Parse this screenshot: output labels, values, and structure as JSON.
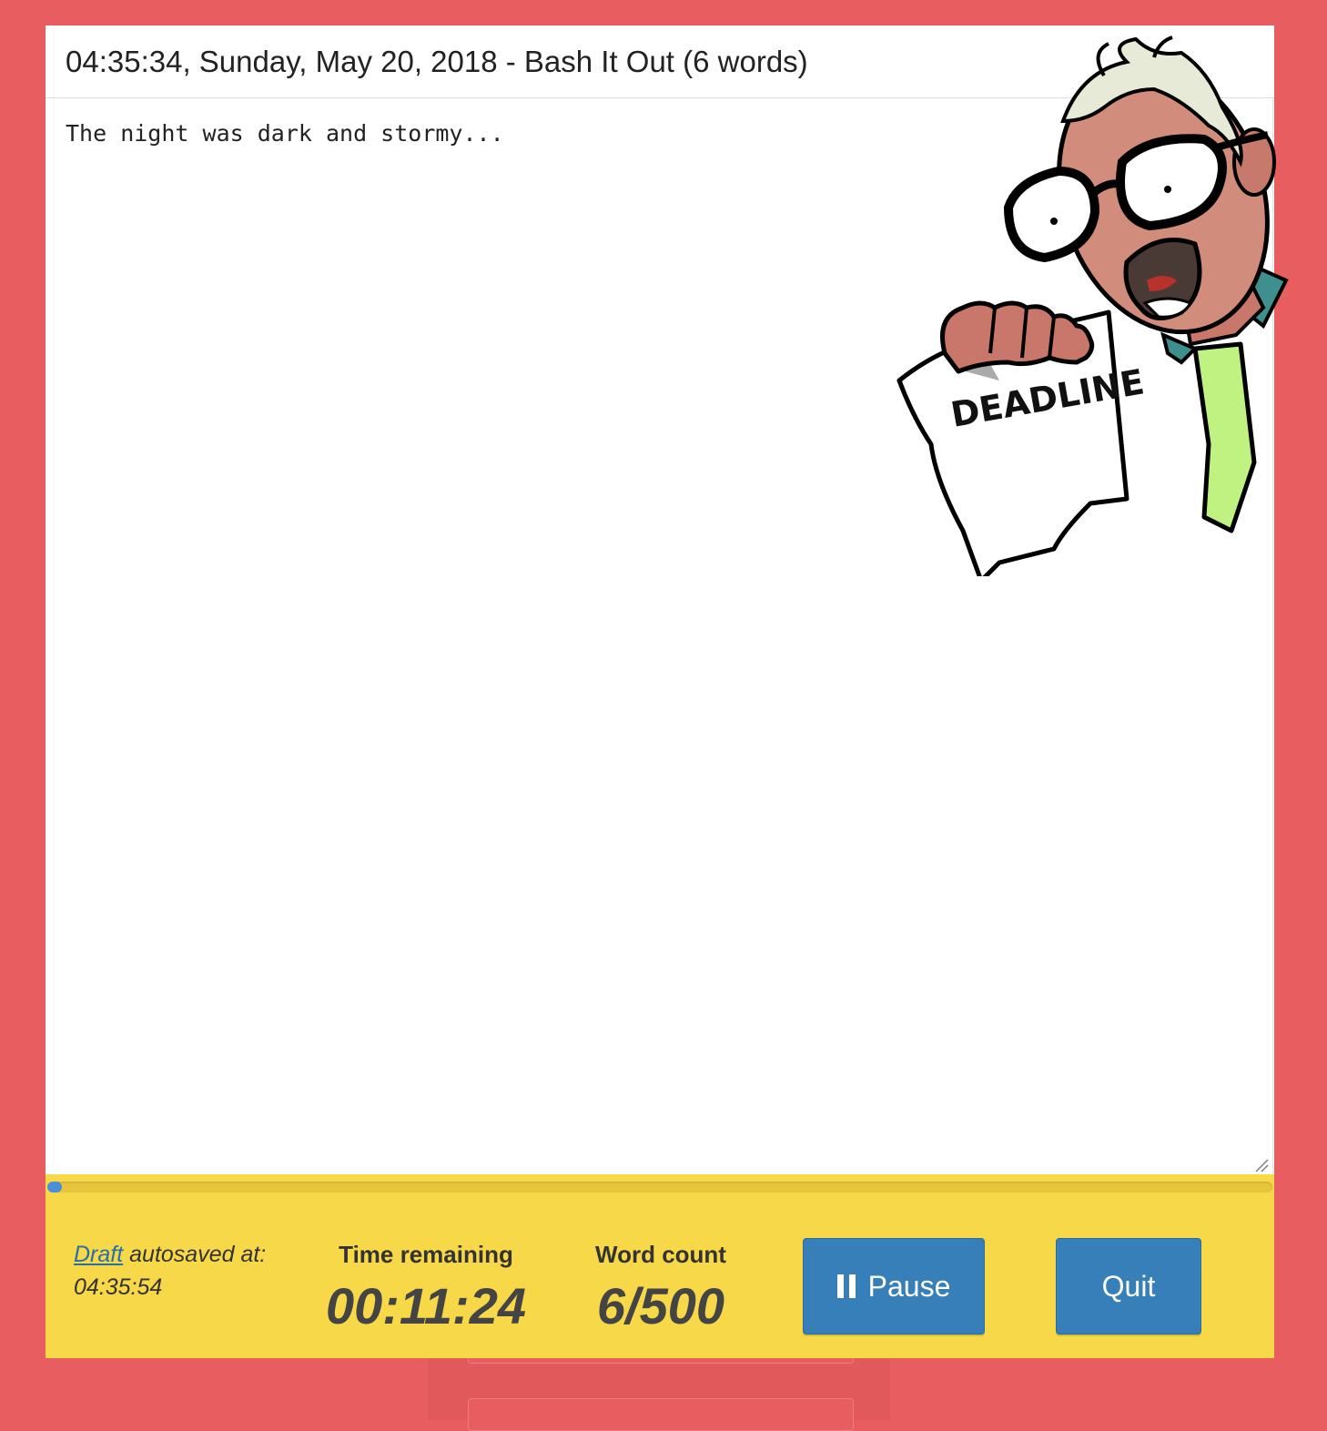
{
  "header": {
    "title": "04:35:34, Sunday, May 20, 2018 - Bash It Out (6 words)"
  },
  "editor": {
    "text": "The night was dark and stormy..."
  },
  "mascot": {
    "icon": "deadline-mascot-icon",
    "paper_text": "DEADLINE"
  },
  "progress": {
    "fraction": 0.012
  },
  "footer": {
    "autosave_link": "Draft",
    "autosave_text": " autosaved at:",
    "autosave_time": "04:35:54",
    "time_label": "Time remaining",
    "time_value": "00:11:24",
    "words_label": "Word count",
    "words_value": "6/500",
    "pause_label": "Pause",
    "quit_label": "Quit"
  },
  "colors": {
    "background": "#e85d5f",
    "footer": "#f7d848",
    "button": "#367fb8",
    "progress_fill": "#4a90d9"
  }
}
